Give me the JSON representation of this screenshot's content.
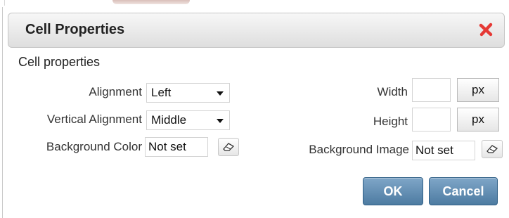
{
  "dialog": {
    "title": "Cell Properties",
    "section_label": "Cell properties"
  },
  "fields": {
    "alignment": {
      "label": "Alignment",
      "value": "Left"
    },
    "vertical_alignment": {
      "label": "Vertical Alignment",
      "value": "Middle"
    },
    "background_color": {
      "label": "Background Color",
      "value": "Not set"
    },
    "width": {
      "label": "Width",
      "value": "",
      "unit": "px"
    },
    "height": {
      "label": "Height",
      "value": "",
      "unit": "px"
    },
    "background_image": {
      "label": "Background Image",
      "value": "Not set"
    }
  },
  "buttons": {
    "ok": "OK",
    "cancel": "Cancel"
  },
  "icons": {
    "close": "close-x-icon",
    "eraser": "eraser-icon"
  },
  "colors": {
    "close_red": "#e53935",
    "primary_button": "#5a84a9",
    "header_bg": "#e6e6e6"
  }
}
